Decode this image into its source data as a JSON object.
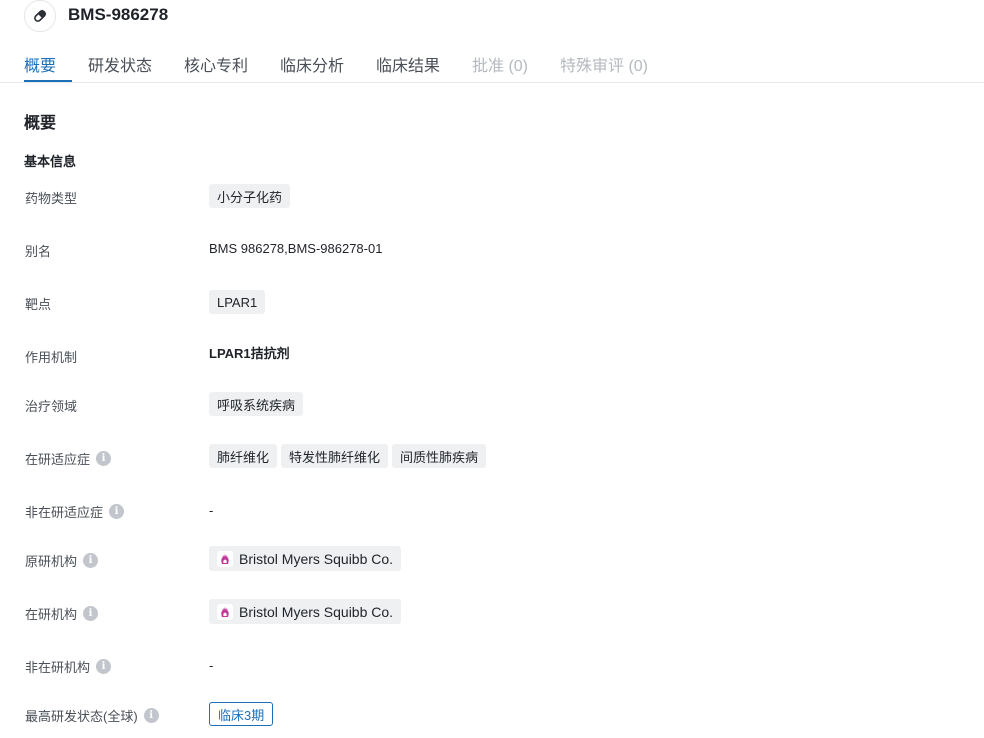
{
  "header": {
    "title": "BMS-986278",
    "icon": "pill-icon"
  },
  "tabs": [
    {
      "label": "概要",
      "state": "active"
    },
    {
      "label": "研发状态",
      "state": "normal"
    },
    {
      "label": "核心专利",
      "state": "normal"
    },
    {
      "label": "临床分析",
      "state": "normal"
    },
    {
      "label": "临床结果",
      "state": "normal"
    },
    {
      "label": "批准 (0)",
      "state": "disabled"
    },
    {
      "label": "特殊审评 (0)",
      "state": "disabled"
    }
  ],
  "overview": {
    "title": "概要",
    "basic_info_title": "基本信息",
    "rows": {
      "drug_type": {
        "label": "药物类型",
        "tags": [
          "小分子化药"
        ]
      },
      "alias": {
        "label": "别名",
        "value": "BMS 986278,BMS-986278-01"
      },
      "target": {
        "label": "靶点",
        "tags": [
          "LPAR1"
        ]
      },
      "mechanism": {
        "label": "作用机制",
        "value": "LPAR1拮抗剂"
      },
      "therapeutic_area": {
        "label": "治疗领域",
        "tags": [
          "呼吸系统疾病"
        ]
      },
      "active_indications": {
        "label": "在研适应症",
        "tags": [
          "肺纤维化",
          "特发性肺纤维化",
          "间质性肺疾病"
        ]
      },
      "inactive_indications": {
        "label": "非在研适应症",
        "value": "-"
      },
      "originator": {
        "label": "原研机构",
        "org": "Bristol Myers Squibb Co."
      },
      "active_org": {
        "label": "在研机构",
        "org": "Bristol Myers Squibb Co."
      },
      "inactive_org": {
        "label": "非在研机构",
        "value": "-"
      },
      "highest_phase": {
        "label": "最高研发状态(全球)",
        "status": "临床3期"
      }
    }
  },
  "colors": {
    "accent": "#1e6fb8",
    "tag_bg": "#eef0f2",
    "disabled": "#b4b9c0",
    "org_logo": "#c0399a"
  }
}
